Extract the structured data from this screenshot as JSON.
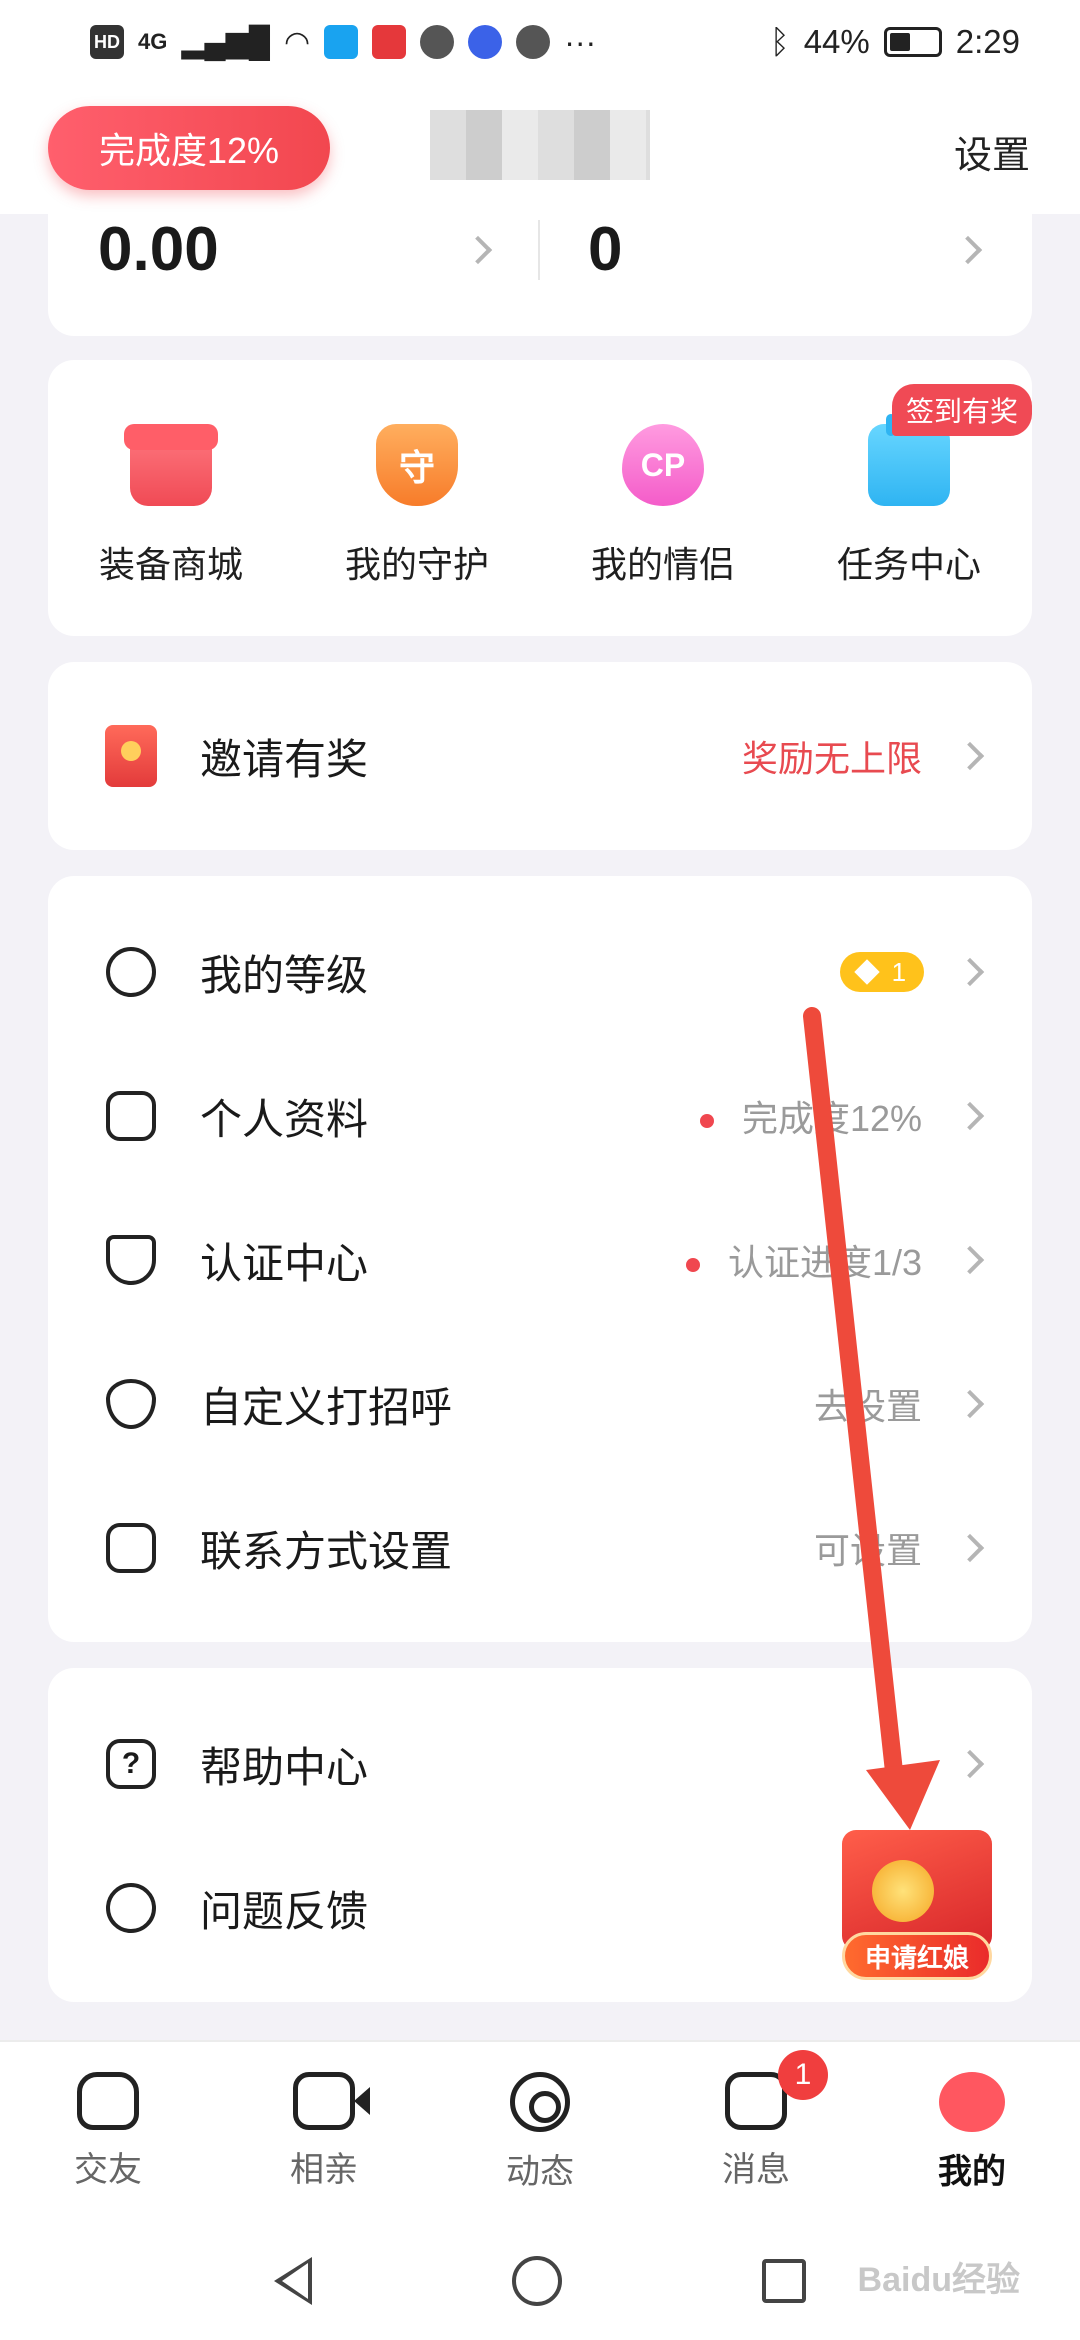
{
  "status_bar": {
    "hd": "HD",
    "net": "4G",
    "battery": "44%",
    "time": "2:29",
    "more": "···"
  },
  "header": {
    "completion_pill": "完成度12%",
    "settings": "设置"
  },
  "stats": {
    "left_value": "0.00",
    "right_value": "0"
  },
  "quick_entries": [
    {
      "label": "装备商城",
      "icon": "shop-icon"
    },
    {
      "label": "我的守护",
      "icon": "guard-icon",
      "glyph": "守"
    },
    {
      "label": "我的情侣",
      "icon": "cp-heart-icon",
      "glyph": "CP"
    },
    {
      "label": "任务中心",
      "icon": "calendar-icon"
    }
  ],
  "sign_badge": "签到有奖",
  "invite": {
    "label": "邀请有奖",
    "value": "奖励无上限"
  },
  "profile_list": [
    {
      "label": "我的等级",
      "level": "1"
    },
    {
      "label": "个人资料",
      "value": "完成度12%"
    },
    {
      "label": "认证中心",
      "value": "认证进度1/3"
    },
    {
      "label": "自定义打招呼",
      "value": "去设置"
    },
    {
      "label": "联系方式设置",
      "value": "可设置"
    }
  ],
  "help_list": [
    {
      "label": "帮助中心"
    },
    {
      "label": "问题反馈"
    }
  ],
  "promo": {
    "label": "申请红娘"
  },
  "tabs": [
    {
      "label": "交友"
    },
    {
      "label": "相亲"
    },
    {
      "label": "动态"
    },
    {
      "label": "消息",
      "badge": "1"
    },
    {
      "label": "我的"
    }
  ],
  "watermark": "Baidu经验",
  "colors": {
    "accent": "#f0474f",
    "background": "#f3f2f7",
    "level_badge": "#ffc21b"
  }
}
